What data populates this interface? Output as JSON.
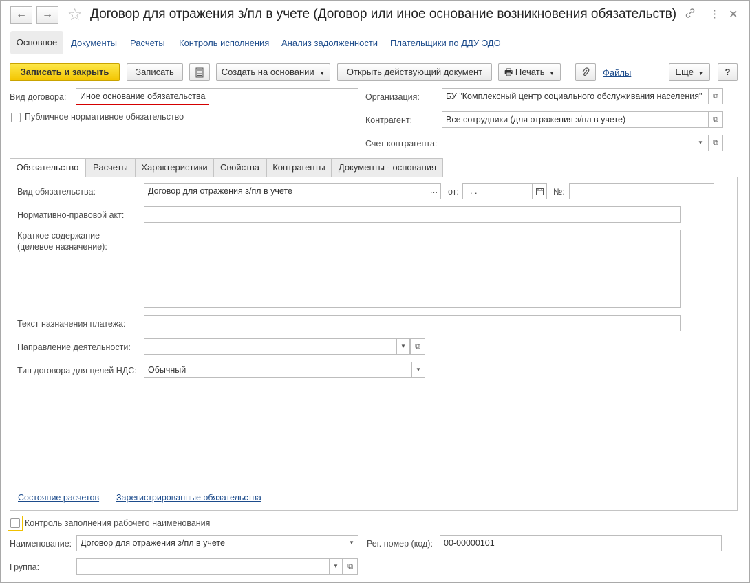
{
  "window": {
    "title": "Договор для отражения з/пл в учете (Договор или иное основание возникновения обязательств)",
    "back_icon": "arrow-left",
    "forward_icon": "arrow-right",
    "favorite_icon": "star",
    "link_icon": "link",
    "more_icon": "vertical-dots",
    "close_icon": "cross"
  },
  "nav": {
    "active": "Основное",
    "links": [
      "Документы",
      "Расчеты",
      "Контроль исполнения",
      "Анализ задолженности",
      "Плательщики по ДДУ ЭДО"
    ]
  },
  "toolbar": {
    "save_close": "Записать и закрыть",
    "save": "Записать",
    "create_based": "Создать на основании",
    "open_current": "Открыть действующий документ",
    "print": "Печать",
    "files": "Файлы",
    "more": "Еще",
    "help": "?"
  },
  "header_form": {
    "contract_type_label": "Вид договора:",
    "contract_type_value": "Иное основание обязательства",
    "public_obligation_label": "Публичное нормативное обязательство",
    "organization_label": "Организация:",
    "organization_value": "БУ \"Комплексный центр социального обслуживания населения\"",
    "counterparty_label": "Контрагент:",
    "counterparty_value": "Все сотрудники (для отражения з/пл в учете)",
    "account_label": "Счет контрагента:",
    "account_value": ""
  },
  "tabs": [
    "Обязательство",
    "Расчеты",
    "Характеристики",
    "Свойства",
    "Контрагенты",
    "Документы - основания"
  ],
  "obligation": {
    "kind_label": "Вид обязательства:",
    "kind_value": "Договор для отражения з/пл в учете",
    "from_label": "от:",
    "date_value": " .  .",
    "number_label": "№:",
    "number_value": "",
    "act_label": "Нормативно-правовой акт:",
    "act_value": "",
    "summary_label_1": "Краткое содержание",
    "summary_label_2": "(целевое назначение):",
    "summary_value": "",
    "payment_text_label": "Текст назначения платежа:",
    "payment_text_value": "",
    "direction_label": "Направление деятельности:",
    "direction_value": "",
    "vat_type_label": "Тип договора для целей НДС:",
    "vat_type_value": "Обычный",
    "settlements_link": "Состояние расчетов",
    "registered_link": "Зарегистрированные обязательства"
  },
  "footer_form": {
    "name_control_label": "Контроль заполнения рабочего наименования",
    "name_label": "Наименование:",
    "name_value": "Договор для отражения з/пл в учете",
    "reg_number_label": "Рег. номер (код):",
    "reg_number_value": "00-00000101",
    "group_label": "Группа:",
    "group_value": ""
  },
  "colors": {
    "primary_button": "#f5cd0f",
    "link": "#1d4c8c",
    "underline_accent": "#d40000"
  }
}
